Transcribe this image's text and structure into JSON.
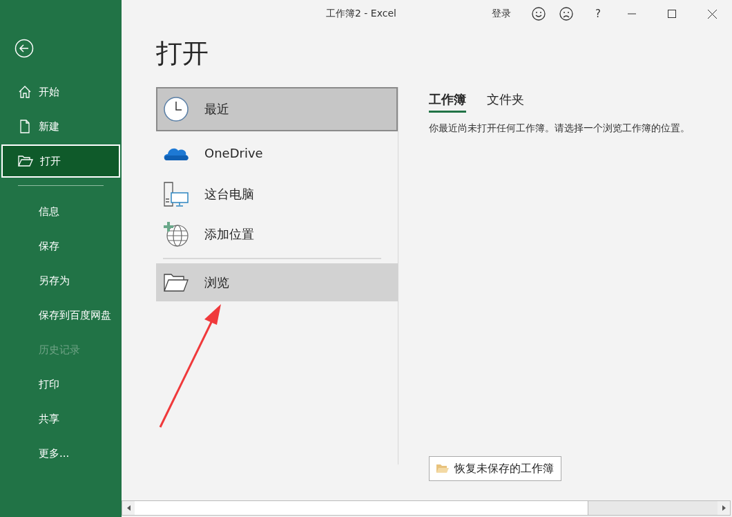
{
  "window": {
    "title": "工作簿2 - Excel",
    "sign_in": "登录",
    "help": "?"
  },
  "sidebar": {
    "primary_items": [
      {
        "label": "开始",
        "selected": false
      },
      {
        "label": "新建",
        "selected": false
      },
      {
        "label": "打开",
        "selected": true
      }
    ],
    "items": [
      {
        "label": "信息",
        "disabled": false
      },
      {
        "label": "保存",
        "disabled": false
      },
      {
        "label": "另存为",
        "disabled": false
      },
      {
        "label": "保存到百度网盘",
        "disabled": false
      },
      {
        "label": "历史记录",
        "disabled": true
      },
      {
        "label": "打印",
        "disabled": false
      },
      {
        "label": "共享",
        "disabled": false
      },
      {
        "label": "更多...",
        "disabled": false
      }
    ]
  },
  "page_title": "打开",
  "places": [
    {
      "label": "最近",
      "selected": true
    },
    {
      "label": "OneDrive",
      "selected": false
    },
    {
      "label": "这台电脑",
      "selected": false
    },
    {
      "label": "添加位置",
      "selected": false
    }
  ],
  "browse": {
    "label": "浏览",
    "hovered": true
  },
  "tabs": [
    {
      "label": "工作簿",
      "selected": true
    },
    {
      "label": "文件夹",
      "selected": false
    }
  ],
  "message": "你最近尚未打开任何工作簿。请选择一个浏览工作簿的位置。",
  "recover_button": "恢复未保存的工作簿"
}
